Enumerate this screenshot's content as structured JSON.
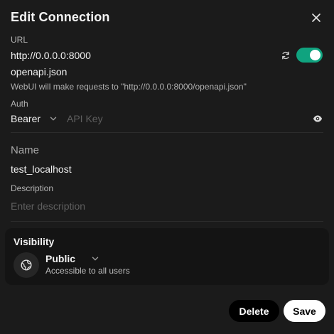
{
  "dialog": {
    "title": "Edit Connection",
    "url_label": "URL",
    "url_value": "http://0.0.0.0:8000",
    "path_value": "openapi.json",
    "url_hint": "WebUI will make requests to \"http://0.0.0.0:8000/openapi.json\"",
    "auth_label": "Auth",
    "auth_type": "Bearer",
    "api_key_placeholder": "API Key",
    "name_label": "Name",
    "name_value": "test_localhost",
    "description_label": "Description",
    "description_placeholder": "Enter description",
    "enabled": true,
    "accent_color": "#10a37f"
  },
  "visibility": {
    "heading": "Visibility",
    "value": "Public",
    "description": "Accessible to all users"
  },
  "actions": {
    "delete_label": "Delete",
    "save_label": "Save"
  },
  "icons": {
    "close": "close-icon",
    "refresh": "refresh-icon",
    "eye": "eye-icon",
    "globe": "globe-icon",
    "chevron": "chevron-down-icon"
  }
}
